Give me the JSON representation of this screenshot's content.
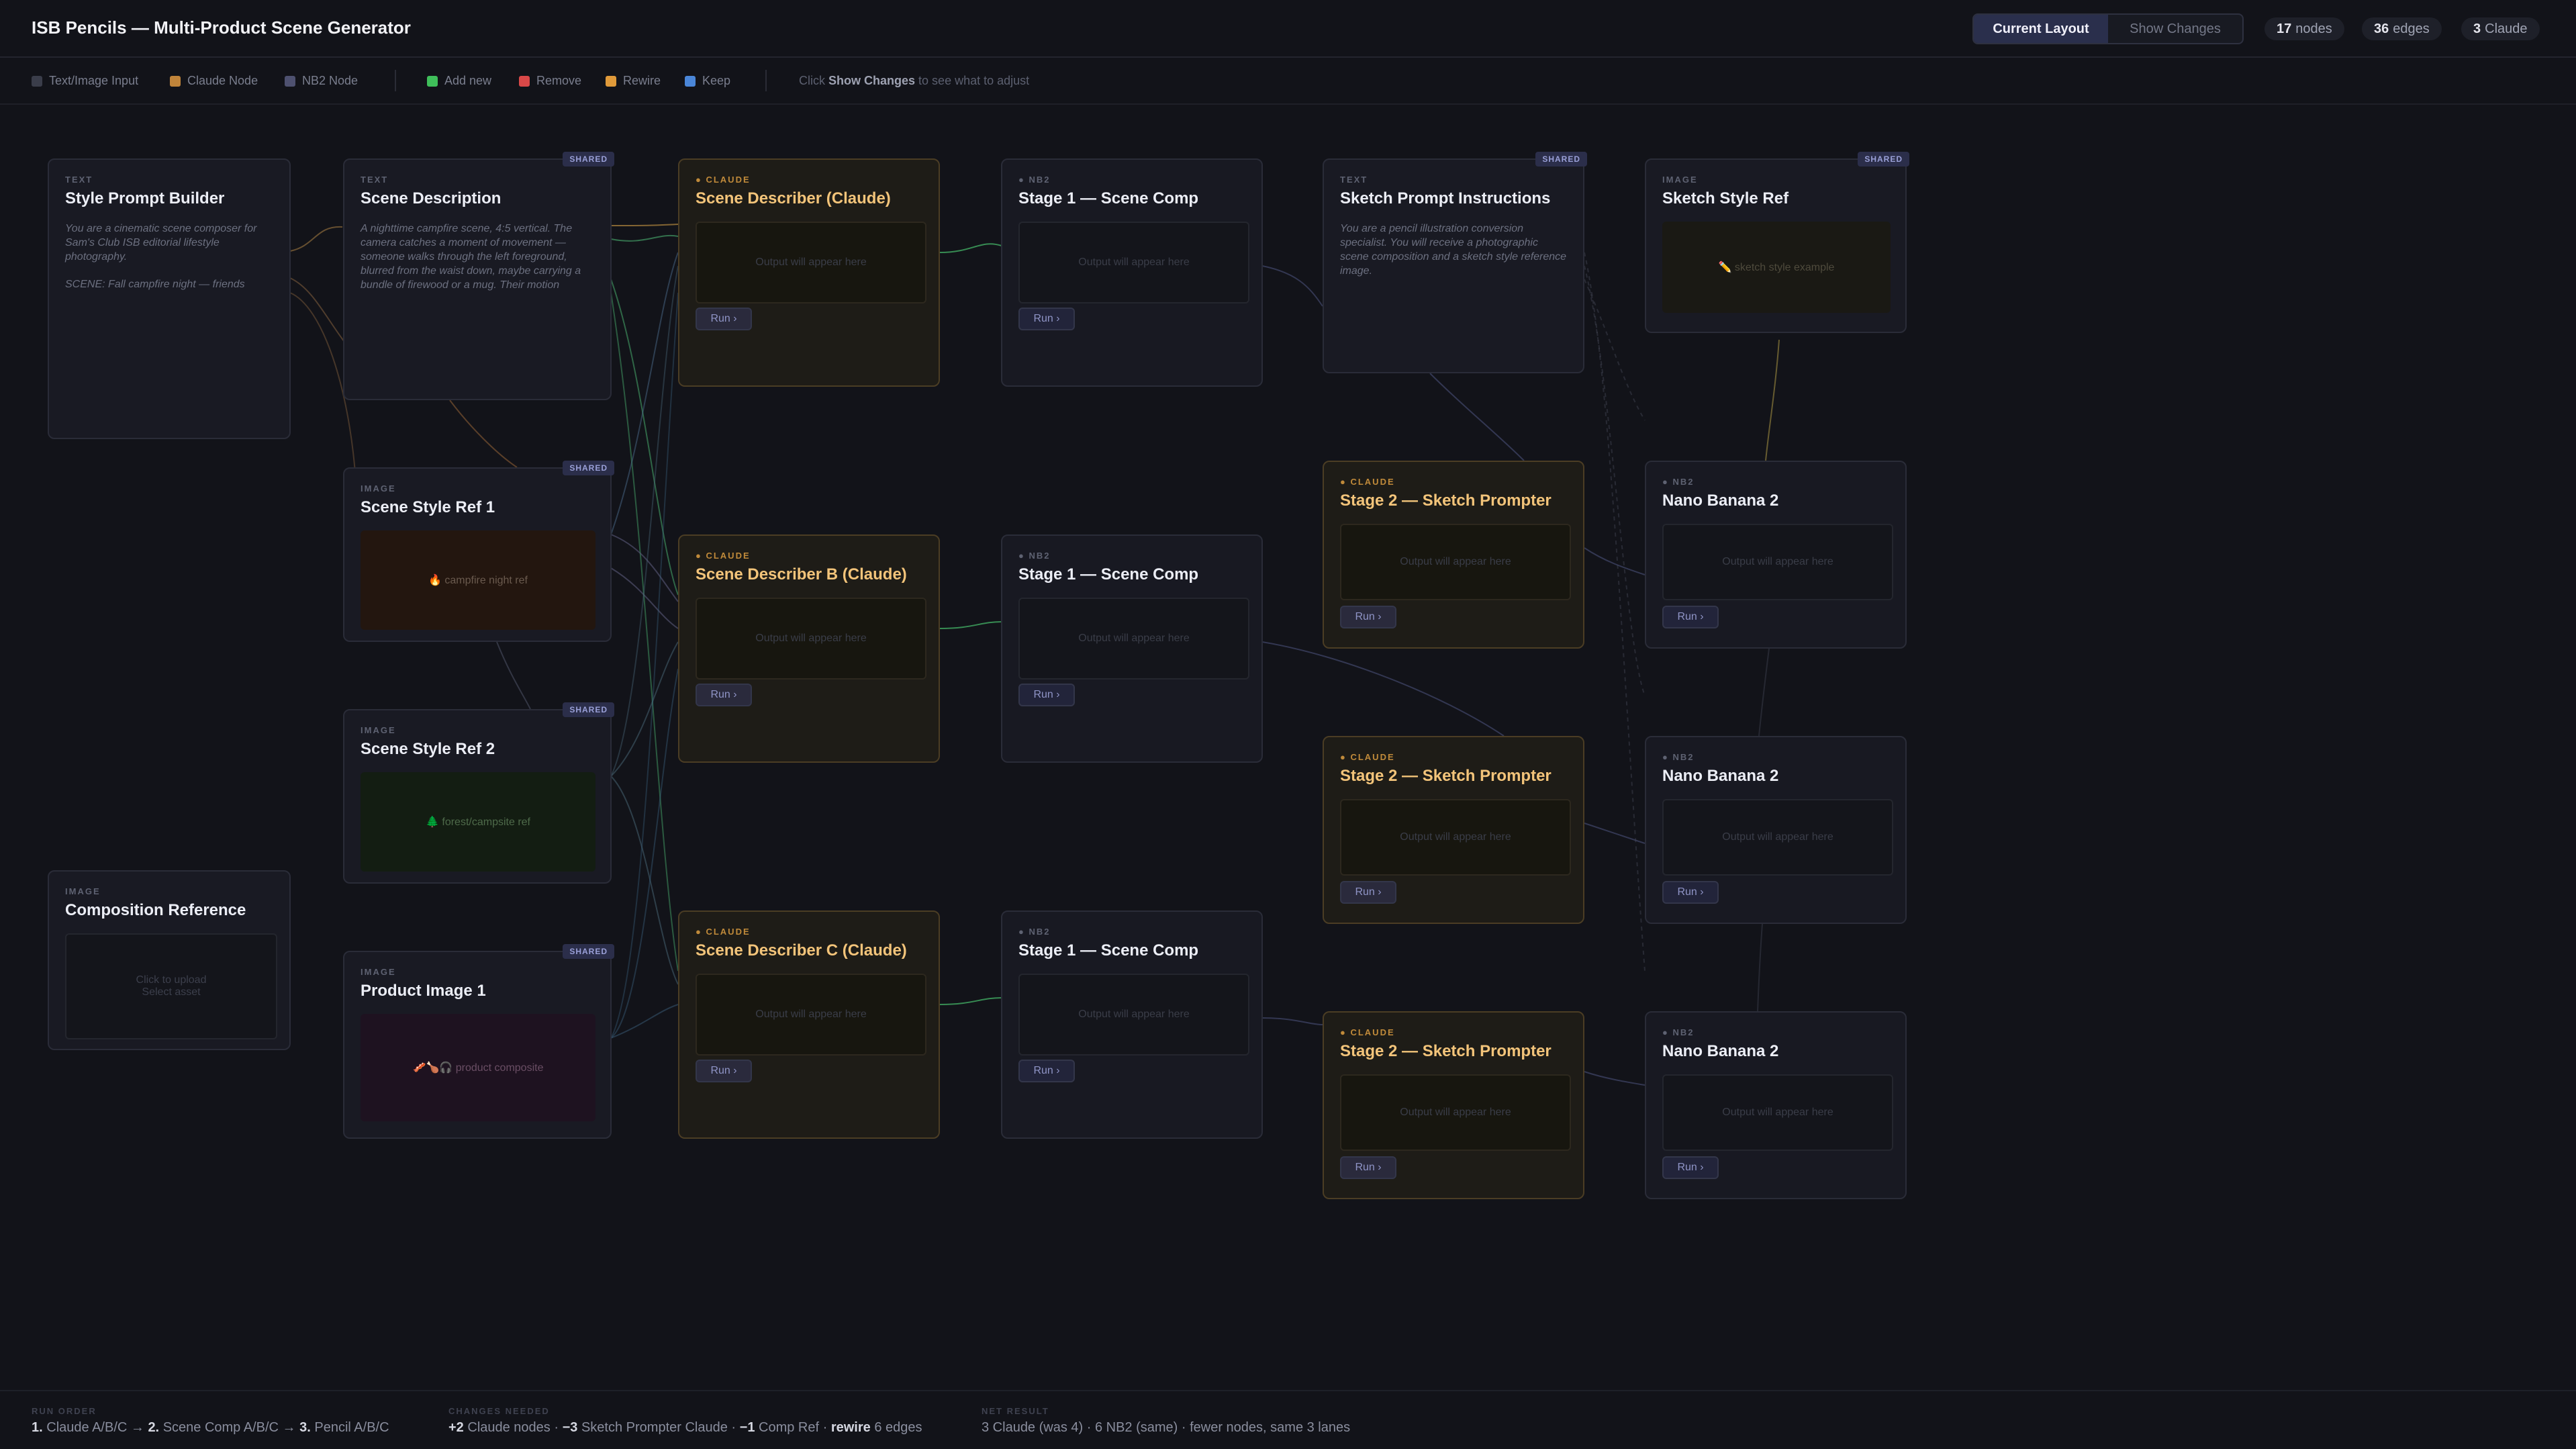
{
  "header": {
    "title": "ISB Pencils — Multi-Product Scene Generator",
    "view_toggle": [
      "Current Layout",
      "Show Changes"
    ],
    "stats": [
      {
        "num": "17",
        "label": "nodes"
      },
      {
        "num": "36",
        "label": "edges"
      },
      {
        "num": "3",
        "label": "Claude"
      }
    ]
  },
  "legend": {
    "types": [
      {
        "label": "Text/Image Input",
        "color": "#3a3d4a"
      },
      {
        "label": "Claude Node",
        "color": "#c0843a"
      },
      {
        "label": "NB2 Node",
        "color": "#4e5170"
      }
    ],
    "changes": [
      {
        "label": "Add new",
        "color": "#3fbf5a"
      },
      {
        "label": "Remove",
        "color": "#d94848"
      },
      {
        "label": "Rewire",
        "color": "#e09a3a"
      },
      {
        "label": "Keep",
        "color": "#4a86d8"
      }
    ],
    "hint_pre": "Click",
    "hint_bold": "Show Changes",
    "hint_post": "to see what to adjust"
  },
  "nodes": {
    "style_prompt_builder": {
      "kind": "TEXT",
      "title": "Style Prompt Builder",
      "text1": "You are a cinematic scene composer for Sam's Club ISB editorial lifestyle photography.",
      "text2": "SCENE: Fall campfire night — friends"
    },
    "scene_description": {
      "kind": "TEXT",
      "title": "Scene Description",
      "badge": "SHARED",
      "text": "A nighttime campfire scene, 4:5 vertical. The camera catches a moment of movement — someone walks through the left foreground, blurred from the waist down, maybe carrying a bundle of firewood or a mug. Their motion"
    },
    "scene_style_ref_1": {
      "kind": "IMAGE",
      "title": "Scene Style Ref 1",
      "badge": "SHARED",
      "image": "🔥 campfire night ref"
    },
    "scene_style_ref_2": {
      "kind": "IMAGE",
      "title": "Scene Style Ref 2",
      "badge": "SHARED",
      "image": "🌲 forest/campsite ref"
    },
    "product_image_1": {
      "kind": "IMAGE",
      "title": "Product Image 1",
      "badge": "SHARED",
      "image": "🥓🍗🎧 product composite"
    },
    "composition_reference": {
      "kind": "IMAGE",
      "title": "Composition Reference",
      "upload_line1": "Click to upload",
      "upload_line2": "Select asset"
    },
    "scene_describer_a": {
      "kind": "● CLAUDE",
      "title": "Scene Describer (Claude)",
      "output": "Output will appear here",
      "run": "Run ›"
    },
    "scene_describer_b": {
      "kind": "● CLAUDE",
      "title": "Scene Describer B (Claude)",
      "output": "Output will appear here",
      "run": "Run ›"
    },
    "scene_describer_c": {
      "kind": "● CLAUDE",
      "title": "Scene Describer C (Claude)",
      "output": "Output will appear here",
      "run": "Run ›"
    },
    "stage1_a": {
      "kind": "● NB2",
      "title": "Stage 1 — Scene Comp",
      "output": "Output will appear here",
      "run": "Run ›"
    },
    "stage1_b": {
      "kind": "● NB2",
      "title": "Stage 1 — Scene Comp",
      "output": "Output will appear here",
      "run": "Run ›"
    },
    "stage1_c": {
      "kind": "● NB2",
      "title": "Stage 1 — Scene Comp",
      "output": "Output will appear here",
      "run": "Run ›"
    },
    "sketch_prompt_instructions": {
      "kind": "TEXT",
      "title": "Sketch Prompt Instructions",
      "badge": "SHARED",
      "text": "You are a pencil illustration conversion specialist. You will receive a photographic scene composition and a sketch style reference image."
    },
    "stage2_a": {
      "kind": "● CLAUDE",
      "title": "Stage 2 — Sketch Prompter",
      "output": "Output will appear here",
      "run": "Run ›"
    },
    "stage2_b": {
      "kind": "● CLAUDE",
      "title": "Stage 2 — Sketch Prompter",
      "output": "Output will appear here",
      "run": "Run ›"
    },
    "stage2_c": {
      "kind": "● CLAUDE",
      "title": "Stage 2 — Sketch Prompter",
      "output": "Output will appear here",
      "run": "Run ›"
    },
    "sketch_style_ref": {
      "kind": "IMAGE",
      "title": "Sketch Style Ref",
      "badge": "SHARED",
      "image": "✏️ sketch style example"
    },
    "nano_a": {
      "kind": "● NB2",
      "title": "Nano Banana 2",
      "output": "Output will appear here",
      "run": "Run ›"
    },
    "nano_b": {
      "kind": "● NB2",
      "title": "Nano Banana 2",
      "output": "Output will appear here",
      "run": "Run ›"
    },
    "nano_c": {
      "kind": "● NB2",
      "title": "Nano Banana 2",
      "output": "Output will appear here",
      "run": "Run ›"
    }
  },
  "footer": {
    "run_order": {
      "label": "RUN ORDER",
      "s1n": "1.",
      "s1": "Claude A/B/C →",
      "s2n": "2.",
      "s2": "Scene Comp A/B/C →",
      "s3n": "3.",
      "s3": "Pencil A/B/C"
    },
    "changes": {
      "label": "CHANGES NEEDED",
      "a": "+2",
      "at": "Claude nodes ·",
      "b": "−3",
      "bt": "Sketch Prompter Claude ·",
      "c": "−1",
      "ct": "Comp Ref ·",
      "d": "rewire",
      "dt": "6 edges"
    },
    "net": {
      "label": "NET RESULT",
      "text": "3 Claude (was 4) · 6 NB2 (same) · fewer nodes, same 3 lanes"
    }
  },
  "colors": {
    "background": "#121319",
    "claude_accent": "#f3c47a",
    "shared_badge": "#2b2e4a"
  }
}
